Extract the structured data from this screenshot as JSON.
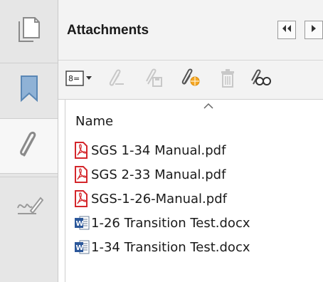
{
  "panel": {
    "title": "Attachments"
  },
  "rail": {
    "items": [
      {
        "icon": "pages-icon"
      },
      {
        "icon": "bookmark-icon"
      },
      {
        "icon": "paperclip-icon",
        "active": true
      },
      {
        "icon": "signatures-icon"
      }
    ]
  },
  "toolbar": {
    "buttons": [
      {
        "icon": "options-menu-icon",
        "enabled": true
      },
      {
        "icon": "open-attachment-icon",
        "enabled": false
      },
      {
        "icon": "save-attachment-icon",
        "enabled": false
      },
      {
        "icon": "add-attachment-icon",
        "enabled": true
      },
      {
        "icon": "delete-icon",
        "enabled": false
      },
      {
        "icon": "search-attachments-icon",
        "enabled": true
      }
    ]
  },
  "list": {
    "column_header": "Name",
    "items": [
      {
        "name": "SGS 1-34 Manual.pdf",
        "type": "pdf"
      },
      {
        "name": "SGS 2-33 Manual.pdf",
        "type": "pdf"
      },
      {
        "name": "SGS-1-26-Manual.pdf",
        "type": "pdf"
      },
      {
        "name": "1-26 Transition Test.docx",
        "type": "docx"
      },
      {
        "name": "1-34 Transition Test.docx",
        "type": "docx"
      }
    ]
  },
  "colors": {
    "pdf_red": "#d4262b",
    "word_blue": "#2b579a",
    "active_clip": "#8a8a8a"
  }
}
